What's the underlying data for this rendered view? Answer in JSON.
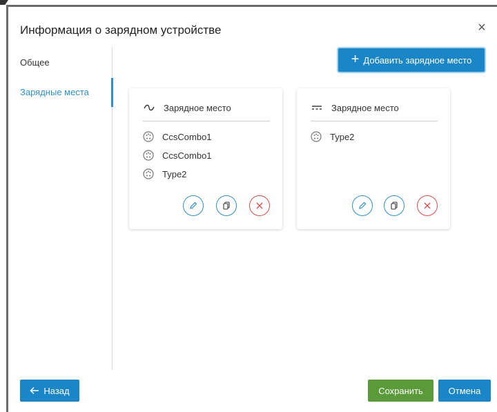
{
  "dialog": {
    "title": "Информация о зарядном устройстве",
    "close_label": "×"
  },
  "nav": {
    "items": [
      {
        "label": "Общее",
        "active": false
      },
      {
        "label": "Зарядные места",
        "active": true
      }
    ]
  },
  "toolbar": {
    "add_label": "Добавить зарядное место"
  },
  "cards": [
    {
      "title": "Зарядное место",
      "current_type": "AC",
      "connectors": [
        "CcsCombo1",
        "CcsCombo1",
        "Type2"
      ]
    },
    {
      "title": "Зарядное место",
      "current_type": "DC",
      "connectors": [
        "Type2"
      ]
    }
  ],
  "footer": {
    "back_label": "Назад",
    "save_label": "Сохранить",
    "cancel_label": "Отмена"
  },
  "colors": {
    "primary": "#1a86c8",
    "success": "#5a9a38",
    "danger": "#d94c4c",
    "active_nav": "#2f8ecb"
  }
}
